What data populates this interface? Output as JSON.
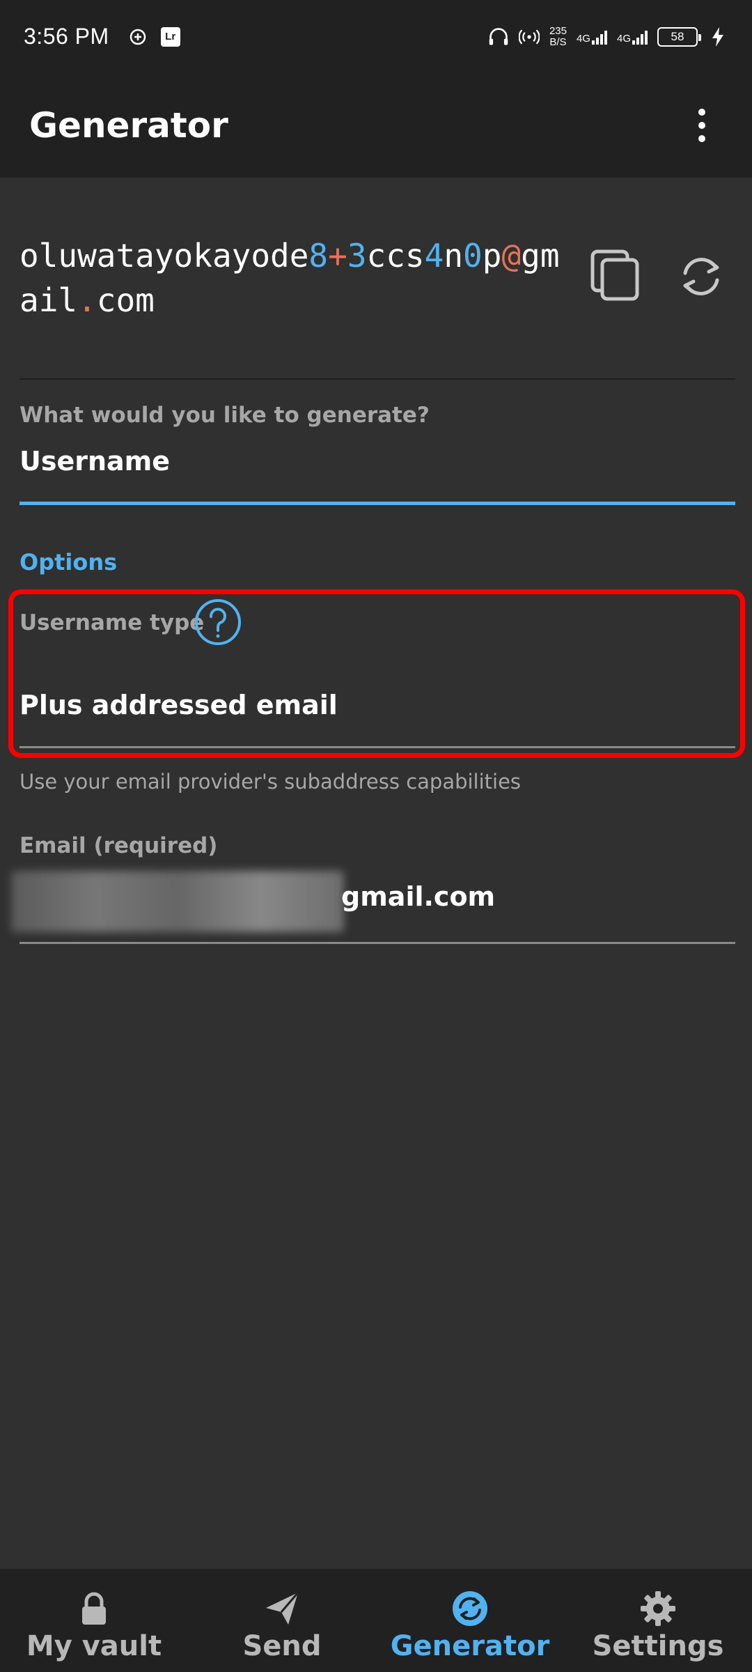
{
  "status_bar": {
    "time": "3:56 PM",
    "speed_value": "235",
    "speed_unit": "B/S",
    "net1": "4G",
    "net2": "4G",
    "battery": "58"
  },
  "app_bar": {
    "title": "Generator"
  },
  "generated": {
    "segments": [
      {
        "text": "oluwatayokayode",
        "kind": "letter"
      },
      {
        "text": "8",
        "kind": "number"
      },
      {
        "text": "+",
        "kind": "symbol"
      },
      {
        "text": "3",
        "kind": "number"
      },
      {
        "text": "ccs",
        "kind": "letter"
      },
      {
        "text": "4",
        "kind": "number"
      },
      {
        "text": "n",
        "kind": "letter"
      },
      {
        "text": "0",
        "kind": "number"
      },
      {
        "text": "p",
        "kind": "letter"
      },
      {
        "text": "@",
        "kind": "symbol"
      },
      {
        "text": "gmail",
        "kind": "letter"
      },
      {
        "text": ".",
        "kind": "symbol"
      },
      {
        "text": "com",
        "kind": "letter"
      }
    ]
  },
  "generate_type": {
    "label": "What would you like to generate?",
    "value": "Username"
  },
  "options": {
    "header": "Options"
  },
  "username_type": {
    "label": "Username type",
    "value": "Plus addressed email",
    "hint": "Use your email provider's subaddress capabilities"
  },
  "email": {
    "label": "Email (required)",
    "value_visible": "gmail.com"
  },
  "bottom_nav": {
    "items": [
      {
        "label": "My vault",
        "icon": "lock-icon"
      },
      {
        "label": "Send",
        "icon": "paper-plane-icon"
      },
      {
        "label": "Generator",
        "icon": "generator-icon",
        "active": true
      },
      {
        "label": "Settings",
        "icon": "gear-icon"
      }
    ]
  },
  "colors": {
    "accent": "#52b2f0",
    "symbol": "#e8725c",
    "highlight": "#ff0000",
    "background": "#303030",
    "bar": "#212121"
  }
}
